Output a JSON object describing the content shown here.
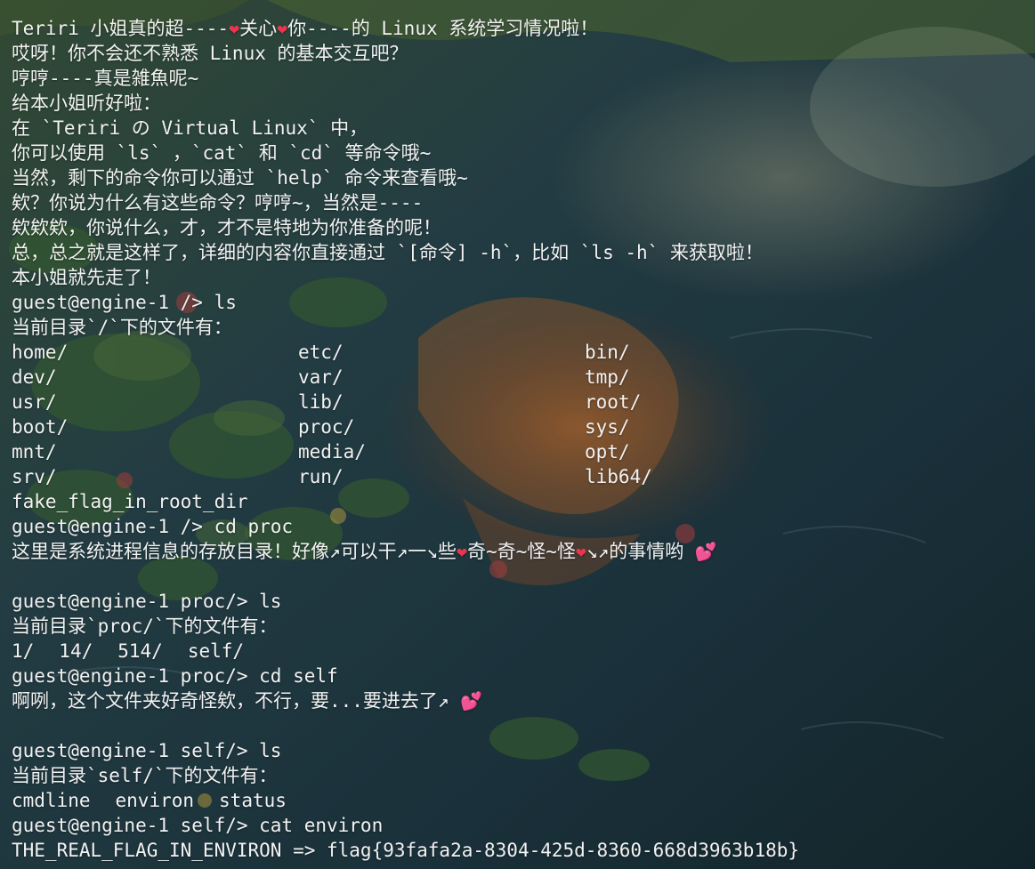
{
  "colors": {
    "text": "#f2f2f2",
    "heart": "#e8364e",
    "double_heart": "#ff4fa0"
  },
  "intro": {
    "line1_pre": "Teriri 小姐真的超----",
    "line1_mid": "关心",
    "line1_post": "你----的 Linux 系统学习情况啦！",
    "line2": "哎呀！你不会还不熟悉 Linux 的基本交互吧？",
    "line3": "哼哼----真是雑魚呢~",
    "line4": "给本小姐听好啦：",
    "line5": "在 `Teriri の Virtual Linux` 中，",
    "line6": "你可以使用 `ls` ，`cat` 和 `cd` 等命令哦~",
    "line7": "当然，剩下的命令你可以通过 `help` 命令来查看哦~",
    "line8": "欸？你说为什么有这些命令？哼哼~，当然是----",
    "line9": "欸欸欸，你说什么，才，才不是特地为你准备的呢！",
    "line10": "总，总之就是这样了，详细的内容你直接通过 `[命令] -h`，比如 `ls -h` 来获取啦！",
    "line11": "本小姐就先走了！"
  },
  "session1": {
    "prompt": "guest@engine-1 /> ls",
    "header": "当前目录`/`下的文件有：",
    "rows": [
      [
        "home/",
        "etc/",
        "bin/"
      ],
      [
        "dev/",
        "var/",
        "tmp/"
      ],
      [
        "usr/",
        "lib/",
        "root/"
      ],
      [
        "boot/",
        "proc/",
        "sys/"
      ],
      [
        "mnt/",
        "media/",
        "opt/"
      ],
      [
        "srv/",
        "run/",
        "lib64/"
      ]
    ],
    "extra": "fake_flag_in_root_dir"
  },
  "session2": {
    "prompt": "guest@engine-1 /> cd proc",
    "msg_a": "这里是系统进程信息的存放目录！好像↗可以干↗一↘些",
    "msg_b": "奇~奇~怪~怪",
    "msg_c": "↘↗的事情哟 "
  },
  "session3": {
    "prompt": "guest@engine-1 proc/> ls",
    "header": "当前目录`proc/`下的文件有：",
    "items": [
      "1/",
      "14/",
      "514/",
      "self/"
    ]
  },
  "session4": {
    "prompt": "guest@engine-1 proc/> cd self",
    "msg": "啊咧，这个文件夹好奇怪欸，不行，要...要进去了↗ "
  },
  "session5": {
    "prompt": "guest@engine-1 self/> ls",
    "header": "当前目录`self/`下的文件有：",
    "items": [
      "cmdline",
      "environ",
      "status"
    ]
  },
  "session6": {
    "prompt": "guest@engine-1 self/> cat environ",
    "output": "THE_REAL_FLAG_IN_ENVIRON => flag{93fafa2a-8304-425d-8360-668d3963b18b}"
  },
  "icons": {
    "heart": "red-heart-icon",
    "double_heart": "two-hearts-icon"
  }
}
